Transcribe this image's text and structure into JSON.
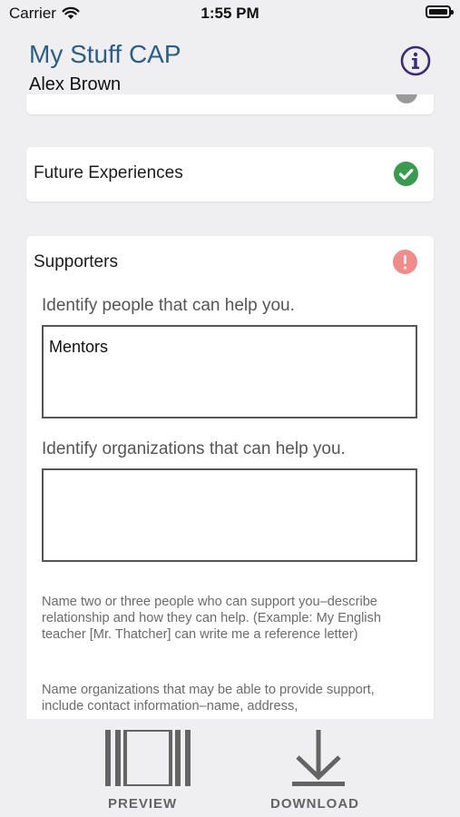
{
  "status": {
    "carrier": "Carrier",
    "time": "1:55 PM"
  },
  "header": {
    "title": "My Stuff CAP",
    "user": "Alex Brown"
  },
  "cards": {
    "future": {
      "title": "Future Experiences",
      "status": "complete"
    },
    "supporters": {
      "title": "Supporters",
      "status": "incomplete",
      "people_prompt": "Identify people that can help you.",
      "people_value": "Mentors",
      "orgs_prompt": "Identify organizations that can help you.",
      "orgs_value": "",
      "help_people": "Name two or three people who can support you–describe relationship and how they can help. (Example: My English teacher [Mr. Thatcher] can write me a reference letter)",
      "help_orgs": "Name organizations that may be able to provide support, include contact information–name, address,"
    }
  },
  "toolbar": {
    "preview_label": "PREVIEW",
    "download_label": "DOWNLOAD"
  },
  "colors": {
    "title": "#2c5f86",
    "check_green": "#3a9a4f",
    "alert_red": "#ef8c8c",
    "info_purple": "#3d2a78",
    "toolbar_gray": "#646464"
  },
  "icons": {
    "info": "info-circle-icon",
    "check": "check-circle-icon",
    "alert": "exclamation-circle-icon",
    "preview": "preview-icon",
    "download": "download-arrow-icon"
  }
}
